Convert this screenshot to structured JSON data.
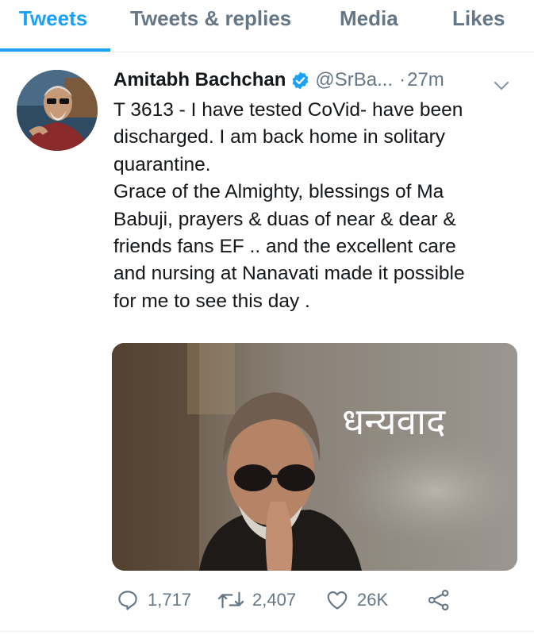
{
  "tabs": [
    {
      "label": "Tweets",
      "active": true
    },
    {
      "label": "Tweets & replies",
      "active": false
    },
    {
      "label": "Media",
      "active": false
    },
    {
      "label": "Likes",
      "active": false
    }
  ],
  "tweet": {
    "author_name": "Amitabh Bachchan",
    "handle": "@SrBa...",
    "separator": "·",
    "time": "27m",
    "verified": true,
    "text_lines": [
      "T 3613 - I have tested CoVid- have been",
      "discharged. I am back home in solitary",
      "quarantine.",
      "Grace of the Almighty, blessings of Ma",
      "Babuji, prayers & duas of near & dear &",
      "friends fans EF .. and the excellent care",
      "and nursing at Nanavati made it possible",
      "for me to see this day ."
    ],
    "media_caption": "धन्यवाद",
    "replies": "1,717",
    "retweets": "2,407",
    "likes": "26K"
  },
  "colors": {
    "accent": "#1da1f2",
    "muted": "#657786",
    "text": "#14171a"
  },
  "icons": [
    "verified-badge-icon",
    "chevron-down-icon",
    "reply-icon",
    "retweet-icon",
    "like-icon",
    "share-icon"
  ]
}
